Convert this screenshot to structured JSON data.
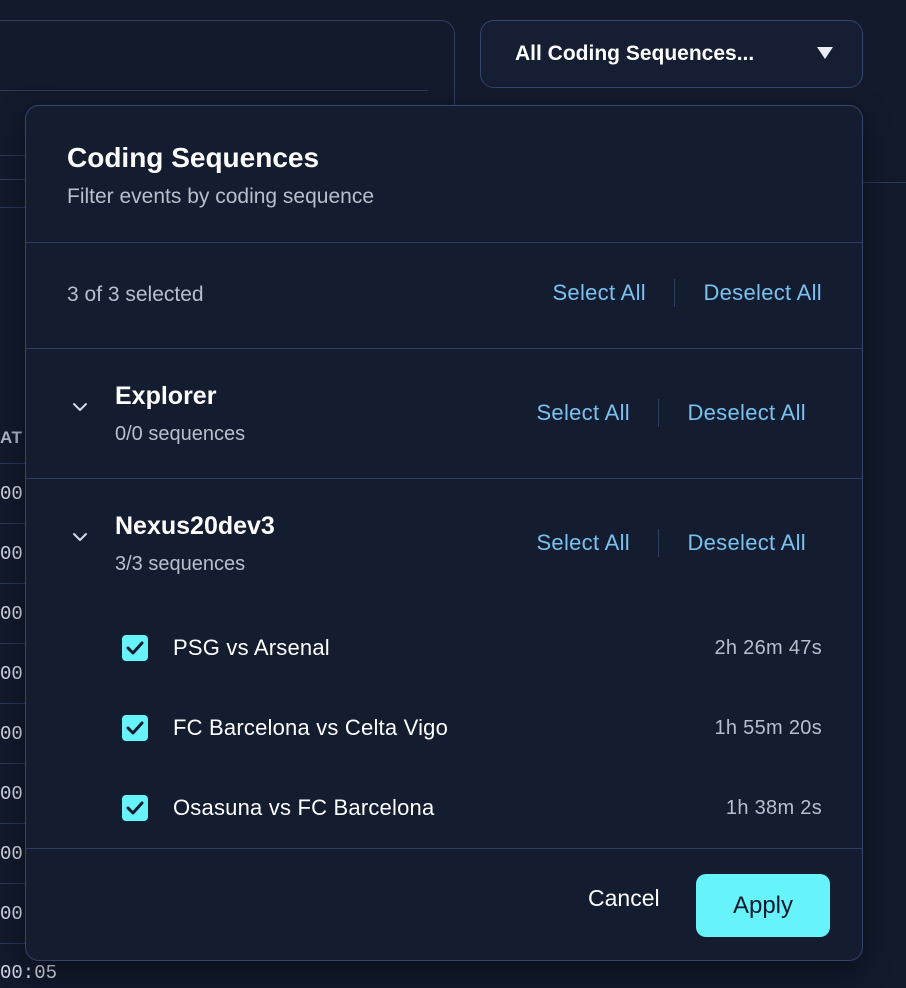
{
  "filter_trigger": {
    "label": "All Coding Sequences...",
    "caret_icon": "triangle-down-icon"
  },
  "background": {
    "column_header": "AT",
    "row_fragments": [
      "00:",
      "00:",
      "00:",
      "00:",
      "00:",
      "00:",
      "00:",
      "00:"
    ],
    "last_row": "00:05"
  },
  "popover": {
    "title": "Coding Sequences",
    "subtitle": "Filter events by coding sequence",
    "summary": "3 of 3 selected",
    "select_all_label": "Select All",
    "deselect_all_label": "Deselect All",
    "groups": [
      {
        "name": "Explorer",
        "count": "0/0 sequences",
        "select_all_label": "Select All",
        "deselect_all_label": "Deselect All"
      },
      {
        "name": "Nexus20dev3",
        "count": "3/3 sequences",
        "select_all_label": "Select All",
        "deselect_all_label": "Deselect All",
        "sequences": [
          {
            "name": "PSG vs Arsenal",
            "duration": "2h 26m 47s",
            "checked": true
          },
          {
            "name": "FC Barcelona vs Celta Vigo",
            "duration": "1h 55m 20s",
            "checked": true
          },
          {
            "name": "Osasuna vs FC Barcelona",
            "duration": "1h 38m 2s",
            "checked": true
          }
        ]
      }
    ],
    "cancel_label": "Cancel",
    "apply_label": "Apply"
  },
  "colors": {
    "background": "#121a2c",
    "panel": "#141c30",
    "border": "#2f3d63",
    "link": "#79c2f0",
    "accent": "#66f3f9"
  }
}
